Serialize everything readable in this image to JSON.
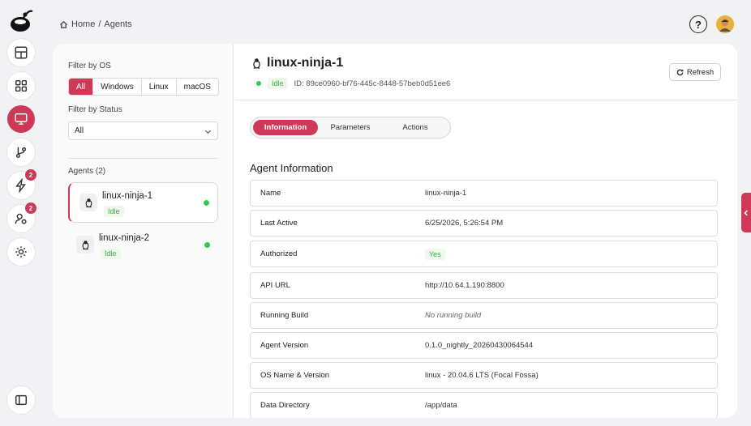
{
  "breadcrumb": {
    "home": "Home",
    "separator": "/",
    "current": "Agents"
  },
  "header": {
    "help_label": "?"
  },
  "rail": {
    "badges": {
      "builds": "2",
      "users": "2"
    }
  },
  "filters": {
    "os_label": "Filter by OS",
    "os_options": [
      "All",
      "Windows",
      "Linux",
      "macOS"
    ],
    "os_selected": "All",
    "status_label": "Filter by Status",
    "status_value": "All"
  },
  "agents": {
    "heading": "Agents (2)",
    "items": [
      {
        "name": "linux-ninja-1",
        "status": "Idle",
        "online": true,
        "selected": true
      },
      {
        "name": "linux-ninja-2",
        "status": "Idle",
        "online": true,
        "selected": false
      }
    ]
  },
  "detail": {
    "title": "linux-ninja-1",
    "status": "Idle",
    "id_text": "ID: 89ce0960-bf76-445c-8448-57beb0d51ee6",
    "refresh_label": "Refresh",
    "tabs": [
      "Information",
      "Parameters",
      "Actions"
    ],
    "active_tab": "Information",
    "section_title": "Agent Information",
    "rows": [
      {
        "key": "Name",
        "value": "linux-ninja-1"
      },
      {
        "key": "Last Active",
        "value": "6/25/2026, 5:26:54 PM"
      },
      {
        "key": "Authorized",
        "value": "Yes"
      },
      {
        "key": "API URL",
        "value": "http://10.64.1.190:8800"
      },
      {
        "key": "Running Build",
        "value": "No running build"
      },
      {
        "key": "Agent Version",
        "value": "0.1.0_nightly_20260430064544"
      },
      {
        "key": "OS Name & Version",
        "value": "linux - 20.04.6 LTS (Focal Fossa)"
      },
      {
        "key": "Data Directory",
        "value": "/app/data"
      }
    ]
  },
  "colors": {
    "accent": "#cf3958",
    "online": "#2ecc51",
    "idle_text": "#3fae3f"
  }
}
